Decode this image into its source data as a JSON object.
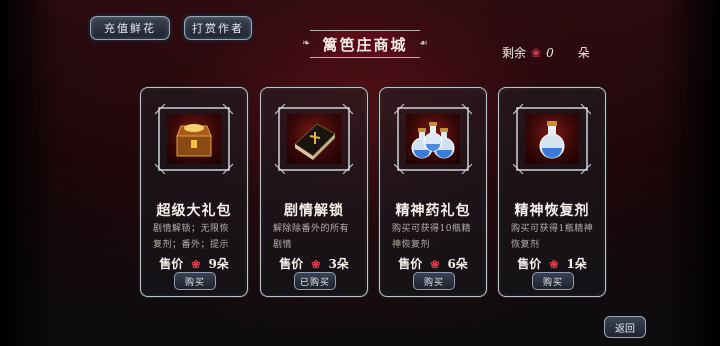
{
  "header": {
    "recharge_label": "充值鲜花",
    "support_label": "打赏作者",
    "title": "篱笆庄商城",
    "remaining_label": "剩余",
    "remaining_count": "0",
    "remaining_unit": "朵"
  },
  "price_label": "售价",
  "cards": [
    {
      "name": "超级大礼包",
      "desc": "剧情解锁；无限恢复剂；番外；提示",
      "price": "9朵",
      "button": "购买",
      "icon": "treasure-chest"
    },
    {
      "name": "剧情解锁",
      "desc": "解除除番外的所有剧情",
      "price": "3朵",
      "button": "已购买",
      "icon": "bible-book"
    },
    {
      "name": "精神药礼包",
      "desc": "购买可获得10瓶精神恢复剂",
      "price": "6朵",
      "button": "购买",
      "icon": "potion-bottles"
    },
    {
      "name": "精神恢复剂",
      "desc": "购买可获得1瓶精神恢复剂",
      "price": "1朵",
      "button": "购买",
      "icon": "potion-bottle"
    }
  ],
  "back_label": "返回",
  "colors": {
    "rose": "#e23a50",
    "accent": "#5a0c18"
  }
}
